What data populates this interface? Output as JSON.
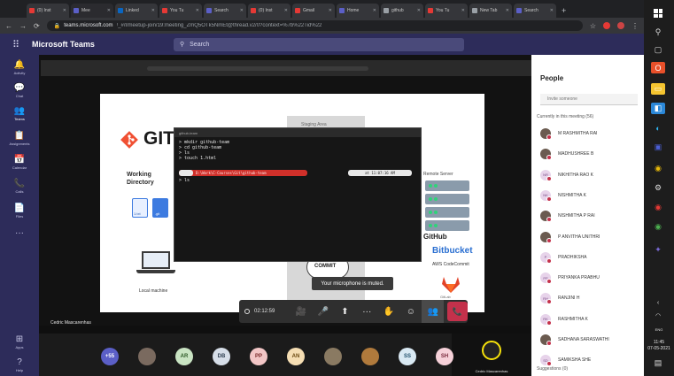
{
  "browser": {
    "tabs": [
      {
        "label": "(0) Inst",
        "color": "#e53935"
      },
      {
        "label": "Mee",
        "color": "#5b5fc7",
        "active": true
      },
      {
        "label": "Linked",
        "color": "#0a66c2"
      },
      {
        "label": "You Tu",
        "color": "#e53935"
      },
      {
        "label": "Search",
        "color": "#5b5fc7"
      },
      {
        "label": "(0) Inst",
        "color": "#e53935"
      },
      {
        "label": "Gmail",
        "color": "#e53935"
      },
      {
        "label": "Home",
        "color": "#5b5fc7"
      },
      {
        "label": "github",
        "color": "#9aa0a6"
      },
      {
        "label": "You Tu",
        "color": "#e53935"
      },
      {
        "label": "New Tab",
        "color": "#9aa0a6"
      },
      {
        "label": "Search",
        "color": "#5b5fc7"
      }
    ],
    "new_tab": "+",
    "url_host": "teams.microsoft.com",
    "url_path": "/_#/l/meetup-join/19:meeting_ZmQ5OTk5NmEt@thread.v2/0?context=%7b%22Tid%22"
  },
  "teams": {
    "app_title": "Microsoft Teams",
    "search_placeholder": "Search"
  },
  "rail": [
    {
      "label": "Activity",
      "icon": "bell-icon",
      "glyph": "🔔"
    },
    {
      "label": "Chat",
      "icon": "chat-icon",
      "glyph": "💬"
    },
    {
      "label": "Teams",
      "icon": "teams-icon",
      "glyph": "👥",
      "active": true
    },
    {
      "label": "Assignments",
      "icon": "assignments-icon",
      "glyph": "📋"
    },
    {
      "label": "Calendar",
      "icon": "calendar-icon",
      "glyph": "📅"
    },
    {
      "label": "Calls",
      "icon": "phone-icon",
      "glyph": "📞"
    },
    {
      "label": "Files",
      "icon": "files-icon",
      "glyph": "📄"
    },
    {
      "label": "",
      "icon": "more-icon",
      "glyph": "···"
    },
    {
      "label": "Apps",
      "icon": "apps-icon",
      "glyph": "⊞"
    },
    {
      "label": "Help",
      "icon": "help-icon",
      "glyph": "?"
    }
  ],
  "slide": {
    "git_word": "GIT",
    "working_directory": "Working Directory",
    "file1": "1.txt",
    "file2": ".git",
    "local_machine": "Local machine",
    "staging": "Staging Area",
    "commit": "COMMIT",
    "remote": "Remote Server",
    "github": "GitHub",
    "bitbucket": "Bitbucket",
    "aws": "AWS CodeCommit",
    "gitlab": "GitLab"
  },
  "terminal": {
    "title": "github-team",
    "lines": [
      "> mkdir github-team",
      "> cd github-team",
      "> ls",
      "> touch 1.html"
    ],
    "prompt_path": "D:\\Work\\C-Courses\\Git\\github-team",
    "prompt_time": "at 11:07:16 AM",
    "last_line": "> ls"
  },
  "toast": "Your microphone is muted.",
  "meeting_toolbar": {
    "timer": "02:12:59",
    "buttons": [
      {
        "name": "camera-off-button",
        "glyph": "🎥"
      },
      {
        "name": "mic-off-button",
        "glyph": "🎤"
      },
      {
        "name": "share-button",
        "glyph": "⬆"
      },
      {
        "name": "more-actions-button",
        "glyph": "···"
      },
      {
        "name": "raise-hand-button",
        "glyph": "✋"
      },
      {
        "name": "reactions-button",
        "glyph": "☺"
      },
      {
        "name": "participants-button",
        "glyph": "👥",
        "selected": true
      }
    ],
    "hangup": "📞"
  },
  "shared_taskbar_name": "Cedric Mascarenhas",
  "participants_strip": [
    {
      "label": "+55",
      "color": "#5b5fc7",
      "text_color": "#ffffff"
    },
    {
      "label": "",
      "color": "#7a6a5f",
      "text_color": "#ffffff"
    },
    {
      "label": "AR",
      "color": "#c9e4c3",
      "text_color": "#2e5a27"
    },
    {
      "label": "DB",
      "color": "#d6dee8",
      "text_color": "#2f3e50"
    },
    {
      "label": "PP",
      "color": "#f2c6c6",
      "text_color": "#7a2a2a"
    },
    {
      "label": "AN",
      "color": "#f5deb3",
      "text_color": "#6b4a12"
    },
    {
      "label": "",
      "color": "#8a7a62",
      "text_color": "#ffffff"
    },
    {
      "label": "",
      "color": "#b07a3c",
      "text_color": "#ffffff"
    },
    {
      "label": "SS",
      "color": "#d9e9f3",
      "text_color": "#1f4e6b"
    },
    {
      "label": "SH",
      "color": "#f6d1d9",
      "text_color": "#7a2a3d"
    }
  ],
  "active_speaker": "Cedric Mascarenhas",
  "people": {
    "title": "People",
    "invite_placeholder": "Invite someone",
    "in_meeting": "Currently in this meeting (56)",
    "list": [
      {
        "initials": "",
        "name": "M RASHMITHA RAI",
        "photo": true
      },
      {
        "initials": "",
        "name": "MADHUSHREE B",
        "photo": true
      },
      {
        "initials": "NR",
        "name": "NIKHITHA RAO K"
      },
      {
        "initials": "NK",
        "name": "NISHMITHA K"
      },
      {
        "initials": "",
        "name": "NISHMITHA P RAI",
        "photo": true
      },
      {
        "initials": "",
        "name": "P ANVITHA UNITHRI",
        "photo": true
      },
      {
        "initials": "P",
        "name": "PRADHIKSHA"
      },
      {
        "initials": "PP",
        "name": "PRIYANKA PRABHU"
      },
      {
        "initials": "RH",
        "name": "RANJINI H"
      },
      {
        "initials": "RK",
        "name": "RASHMITHA K"
      },
      {
        "initials": "",
        "name": "SADHANA SARASWATHI",
        "photo": true
      },
      {
        "initials": "SD",
        "name": "SAMIKSHA SHE"
      }
    ],
    "suggestions": "Suggestions (0)"
  },
  "windows": {
    "lang": "ENG",
    "time": "11:45",
    "date": "07-05-2021"
  },
  "colors": {
    "teams_header": "#2d2c5a",
    "accent": "#5b5fc7",
    "hangup": "#c4314b",
    "terminal_prompt": "#d0302a"
  }
}
